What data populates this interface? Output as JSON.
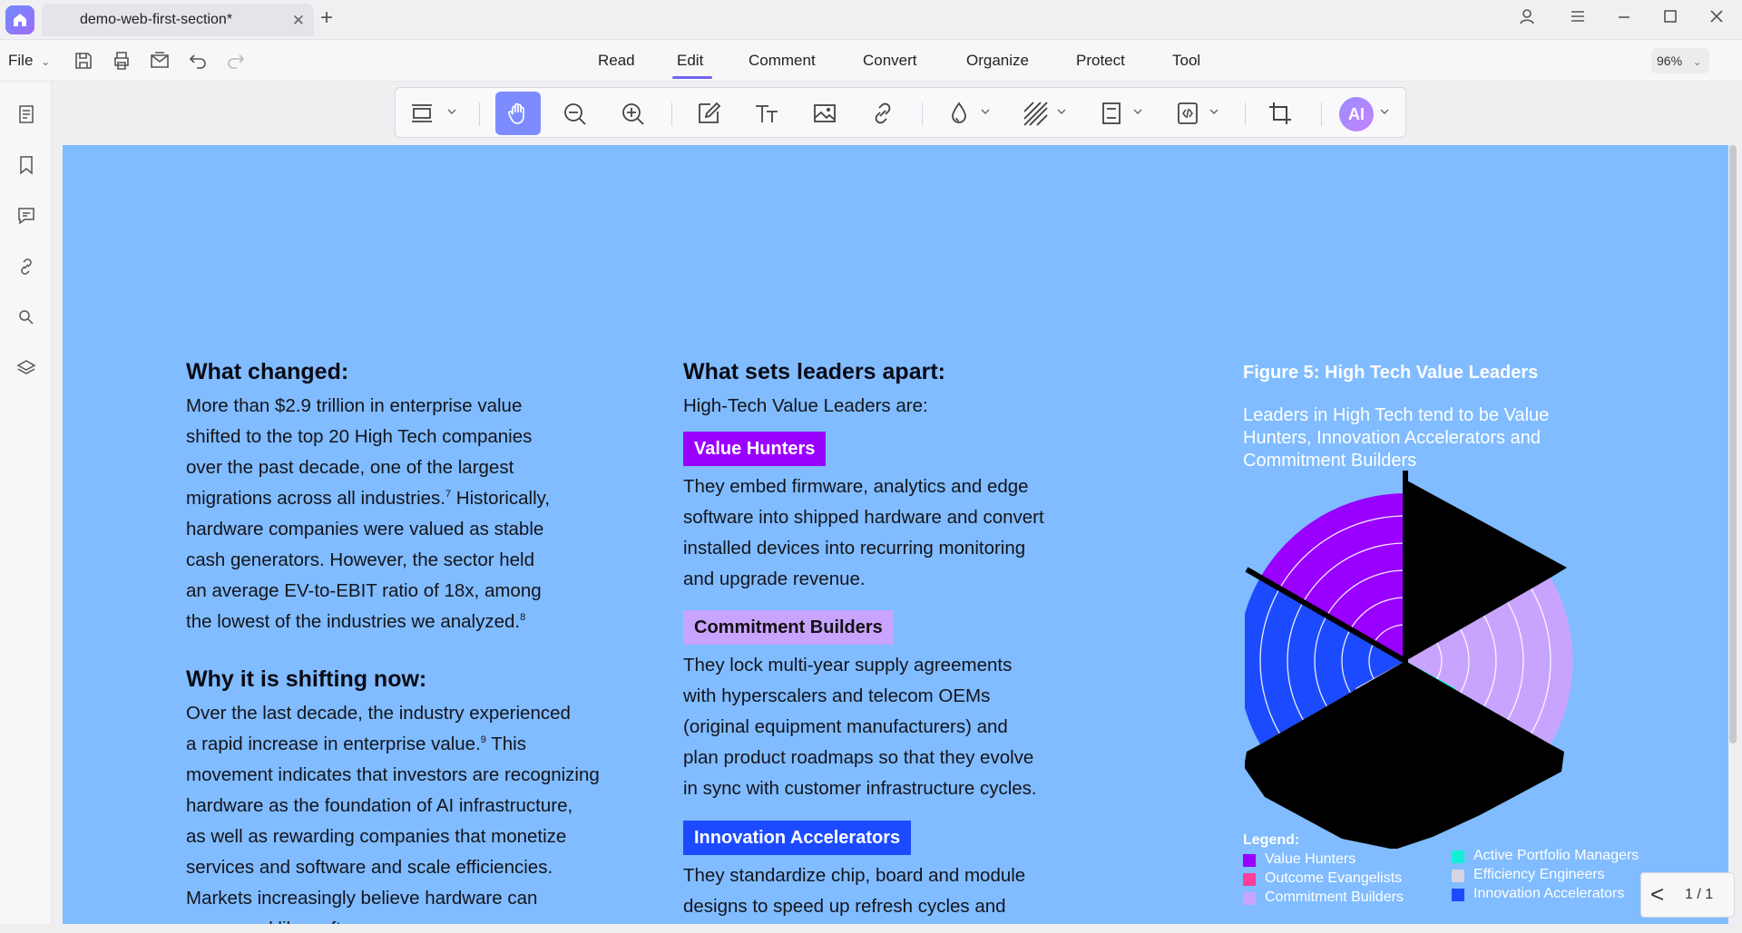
{
  "window": {
    "tab_title": "demo-web-first-section*",
    "tab_close": "✕",
    "new_tab": "+",
    "controls": [
      "account-icon",
      "menu-icon",
      "minimize-icon",
      "maximize-icon",
      "close-icon"
    ]
  },
  "menu": {
    "file_label": "File",
    "tabs": [
      "Read",
      "Edit",
      "Comment",
      "Convert",
      "Organize",
      "Protect",
      "Tool"
    ],
    "active_tab": "Edit",
    "zoom": "96%"
  },
  "toolbar": {
    "ai_label": "AI",
    "accent_color": "#7c8cff"
  },
  "document": {
    "col1": {
      "heading1": "What changed:",
      "para1_lines": [
        "More than $2.9 trillion in enterprise value",
        "shifted to the top 20 High Tech companies",
        "over the past decade, one of the largest",
        "migrations across all industries.",
        "hardware companies were valued as stable",
        "cash generators. However, the sector held",
        "an average EV-to-EBIT ratio of 18x, among",
        "the lowest of the industries we analyzed."
      ],
      "para1_line4_rest": " Historically,",
      "sup7": "7",
      "sup8": "8",
      "heading2": "Why it is shifting now:",
      "para2_lines": [
        "Over the last decade, the industry experienced",
        "a rapid increase in enterprise value.",
        "movement indicates that investors are recognizing",
        "hardware as the foundation of AI infrastructure,",
        "as well as rewarding companies that monetize",
        "services and software and scale efficiencies.",
        "Markets increasingly believe hardware can",
        "compound like software."
      ],
      "sup9": "9",
      "para2_line2_rest": " This"
    },
    "col2": {
      "heading": "What sets leaders apart:",
      "intro": "High-Tech Value Leaders are:",
      "items": [
        {
          "tag": "Value Hunters",
          "tag_bg": "#9a00ff",
          "tag_fg": "#ffffff",
          "lines": [
            "They embed firmware, analytics and edge",
            "software into shipped hardware and convert",
            "installed devices into recurring monitoring",
            "and upgrade revenue."
          ]
        },
        {
          "tag": "Commitment Builders",
          "tag_bg": "#c9a4ff",
          "tag_fg": "#111111",
          "lines": [
            "They lock multi-year supply agreements",
            "with hyperscalers and telecom OEMs",
            "(original equipment manufacturers) and",
            "plan product roadmaps so that they evolve",
            "in sync with customer infrastructure cycles."
          ]
        },
        {
          "tag": "Innovation Accelerators",
          "tag_bg": "#1c4bff",
          "tag_fg": "#ffffff",
          "lines": [
            "They standardize chip, board and module",
            "designs to speed up refresh cycles and"
          ]
        }
      ]
    },
    "figure": {
      "title": "Figure 5: High Tech Value Leaders",
      "subtitle": "Leaders in High Tech tend to be Value Hunters, Innovation Accelerators and Commitment Builders",
      "legend_title": "Legend:",
      "legend": [
        {
          "label": "Value Hunters",
          "color": "#9a00ff"
        },
        {
          "label": "Outcome Evangelists",
          "color": "#ff3d9a"
        },
        {
          "label": "Commitment Builders",
          "color": "#c9a4ff"
        },
        {
          "label": "Active Portfolio Managers",
          "color": "#12f0d6"
        },
        {
          "label": "Efficiency Engineers",
          "color": "#d4d4e4"
        },
        {
          "label": "Innovation Accelerators",
          "color": "#1c4bff"
        }
      ]
    }
  },
  "pager": {
    "prev": "<",
    "label": "1 / 1"
  }
}
